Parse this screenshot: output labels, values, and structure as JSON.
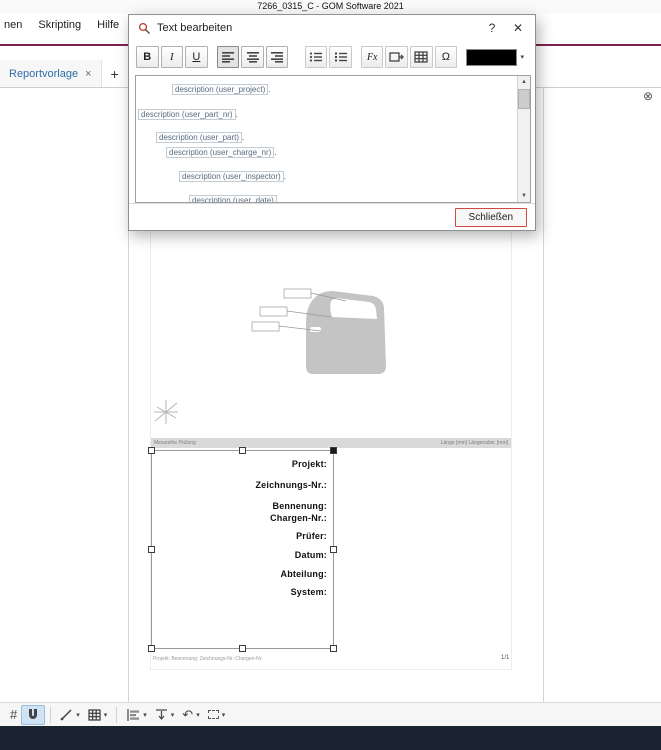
{
  "glyphs": {
    "caret": "▾",
    "close_x": "✕",
    "tab_close": "×",
    "help": "?",
    "scroll_up": "▲",
    "scroll_down": "▼",
    "panel_close": "⊗",
    "undo": "↶",
    "grid_hash": "#",
    "add_tab": "+",
    "omega": "Ω",
    "fx": "Fx",
    "bold": "B",
    "italic": "I",
    "underline": "U"
  },
  "colors": {
    "accent_magenta": "#7d2150",
    "dark_statusbar": "#1a2430",
    "text_color_swatch": "#000000"
  },
  "window": {
    "title": "7266_0315_C - GOM Software 2021"
  },
  "menubar": {
    "items": [
      "nen",
      "Skripting",
      "Hilfe"
    ]
  },
  "tabbar": {
    "active_tab": "Reportvorlage"
  },
  "dialog": {
    "title": "Text bearbeiten",
    "close_button": "Schließen",
    "lines": [
      {
        "token": "description (user_project)",
        "suffix": "."
      },
      {
        "token": "description (user_part_nr)",
        "suffix": "."
      },
      {
        "token": "description (user_part)",
        "suffix": "."
      },
      {
        "token": "description (user_charge_nr)",
        "suffix": "."
      },
      {
        "token": "description (user_inspector)",
        "suffix": "."
      },
      {
        "token": "description (user_date)",
        "suffix": "."
      }
    ]
  },
  "report": {
    "band_left": "Messreihe Prüfung",
    "band_right": "Länge [mm]   Längenabw. [mm]",
    "labels": [
      "Projekt:",
      "Zeichnungs-Nr.:",
      "Bennenung:",
      "Chargen-Nr.:",
      "Prüfer:",
      "Datum:",
      "Abteilung:",
      "System:"
    ],
    "footer_left": "Projekt:   Bennenung:   Zeichnungs-Nr:   Chargen-Nr:",
    "page_number": "1/1"
  }
}
